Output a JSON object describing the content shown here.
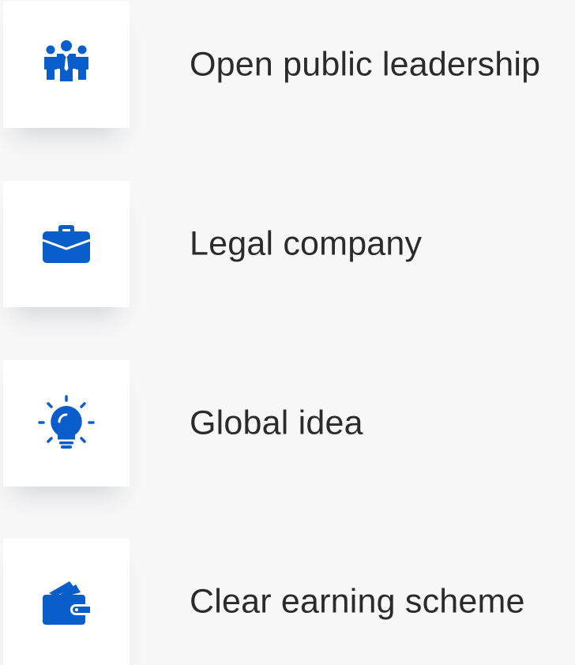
{
  "accent_color": "#0a5ecc",
  "features": [
    {
      "icon": "team-icon",
      "label": "Open public leadership"
    },
    {
      "icon": "briefcase-icon",
      "label": "Legal company"
    },
    {
      "icon": "lightbulb-icon",
      "label": "Global idea"
    },
    {
      "icon": "wallet-icon",
      "label": "Clear earning scheme"
    }
  ]
}
